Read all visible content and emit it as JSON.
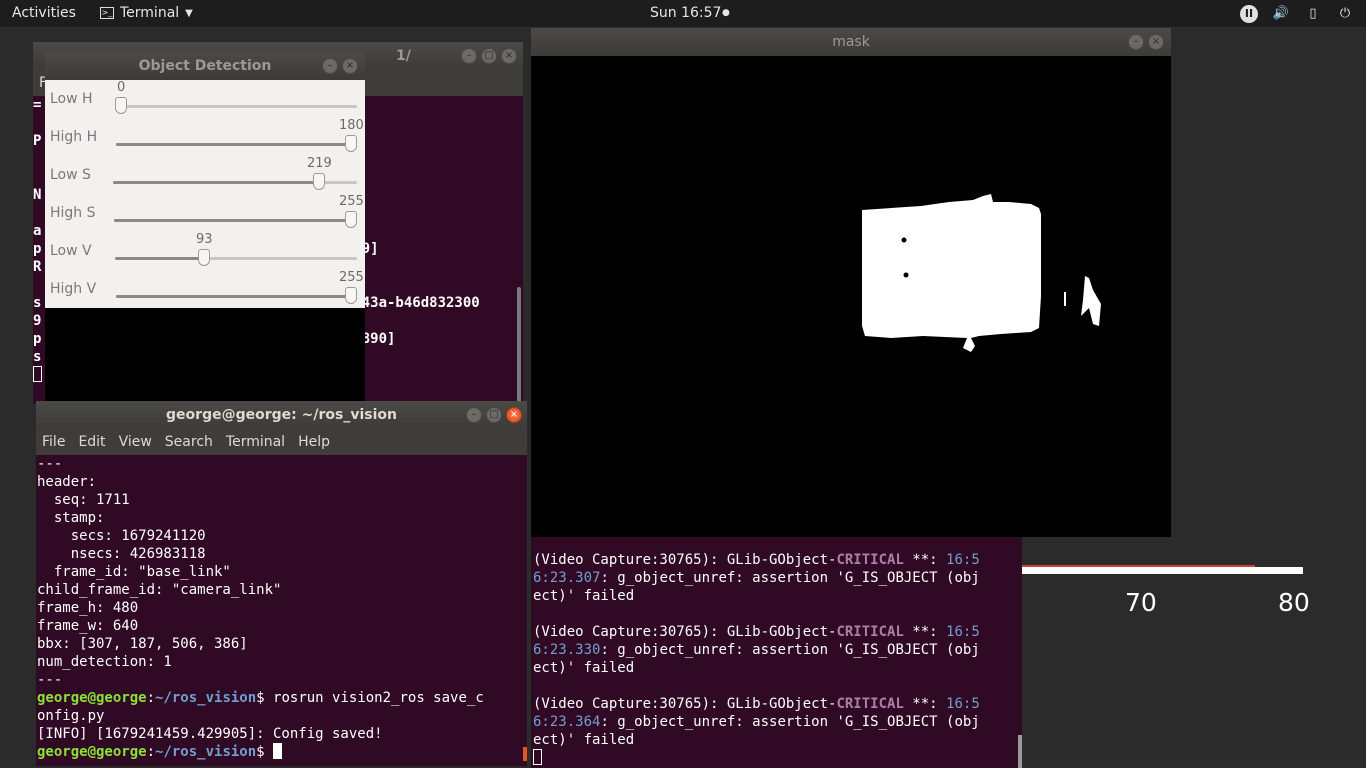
{
  "topbar": {
    "activities": "Activities",
    "app_name": "Terminal",
    "clock": "Sun 16:57",
    "tray_icons": [
      "ros-indicator-icon",
      "volume-icon",
      "battery-icon",
      "power-icon"
    ]
  },
  "background_chart": {
    "tick_labels": [
      "70",
      "80"
    ]
  },
  "back_terminal": {
    "title_fragment": "1/",
    "menu_fragment": "F",
    "lines": [
      "=",
      "",
      "P",
      "",
      "",
      "N",
      "",
      "a",
      "p                                    869]",
      "R",
      "",
      "s                                    -a43a-b46d832300",
      "9",
      "p                                    24890]",
      "s"
    ]
  },
  "object_detection": {
    "title": "Object Detection",
    "sliders": [
      {
        "label": "Low H",
        "value": "0",
        "fraction": 0.0
      },
      {
        "label": "High H",
        "value": "180",
        "fraction": 1.0
      },
      {
        "label": "Low S",
        "value": "219",
        "fraction": 0.86
      },
      {
        "label": "High S",
        "value": "255",
        "fraction": 1.0
      },
      {
        "label": "Low V",
        "value": "93",
        "fraction": 0.36
      },
      {
        "label": "High V",
        "value": "255",
        "fraction": 1.0
      }
    ]
  },
  "front_terminal": {
    "title": "george@george: ~/ros_vision",
    "menu": [
      "File",
      "Edit",
      "View",
      "Search",
      "Terminal",
      "Help"
    ],
    "lines": [
      "---",
      "header:",
      "  seq: 1711",
      "  stamp:",
      "    secs: 1679241120",
      "    nsecs: 426983118",
      "  frame_id: \"base_link\"",
      "child_frame_id: \"camera_link\"",
      "frame_h: 480",
      "frame_w: 640",
      "bbx: [307, 187, 506, 386]",
      "num_detection: 1",
      "---"
    ],
    "prompt_user": "george@george",
    "prompt_path": "~/ros_vision",
    "command_line1": "$ rosrun vision2_ros save_c",
    "command_line2": "onfig.py",
    "info_line": "[INFO] [1679241459.429905]: Config saved!",
    "prompt2_suffix": "$ "
  },
  "mask_window": {
    "title": "mask"
  },
  "video_terminal": {
    "entries": [
      {
        "prefix": "(Video Capture:30765): GLib-GObject-",
        "level": "CRITICAL",
        "sep": " **: ",
        "ts1": "16:5",
        "ts2": "6:23.307",
        "msg1": ": g_object_unref: assertion 'G_IS_OBJECT (obj",
        "msg2": "ect)' failed"
      },
      {
        "prefix": "(Video Capture:30765): GLib-GObject-",
        "level": "CRITICAL",
        "sep": " **: ",
        "ts1": "16:5",
        "ts2": "6:23.330",
        "msg1": ": g_object_unref: assertion 'G_IS_OBJECT (obj",
        "msg2": "ect)' failed"
      },
      {
        "prefix": "(Video Capture:30765): GLib-GObject-",
        "level": "CRITICAL",
        "sep": " **: ",
        "ts1": "16:5",
        "ts2": "6:23.364",
        "msg1": ": g_object_unref: assertion 'G_IS_OBJECT (obj",
        "msg2": "ect)' failed"
      }
    ]
  }
}
